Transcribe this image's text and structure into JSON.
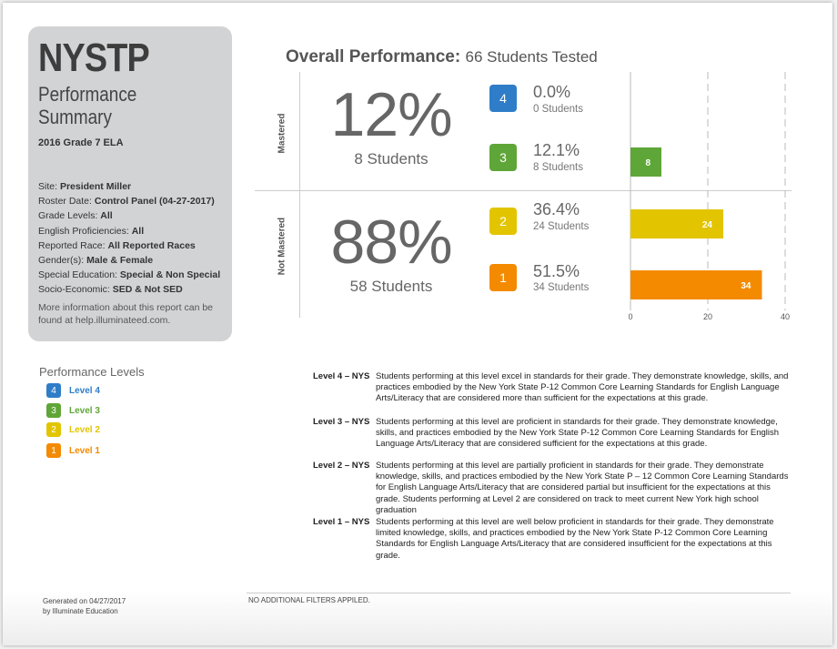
{
  "card": {
    "brand": "NYSTP",
    "subtitle_1": "Performance",
    "subtitle_2": "Summary",
    "grade": "2016 Grade 7 ELA",
    "meta": [
      {
        "label": "Site: ",
        "value": "President Miller"
      },
      {
        "label": "Roster Date: ",
        "value": "Control Panel (04-27-2017)"
      },
      {
        "label": "Grade Levels: ",
        "value": "All"
      },
      {
        "label": "English Proficiencies: ",
        "value": "All"
      },
      {
        "label": "Reported Race: ",
        "value": "All Reported Races"
      },
      {
        "label": "Gender(s): ",
        "value": "Male & Female"
      },
      {
        "label": "Special Education: ",
        "value": "Special & Non Special"
      },
      {
        "label": "Socio-Economic: ",
        "value": "SED & Not SED"
      }
    ],
    "more_info": "More information about this report can be found at help.illuminateed.com."
  },
  "legend": {
    "title": "Performance Levels",
    "items": [
      {
        "num": "4",
        "label": "Level 4",
        "color": "#2f7dc8"
      },
      {
        "num": "3",
        "label": "Level 3",
        "color": "#5fa638"
      },
      {
        "num": "2",
        "label": "Level 2",
        "color": "#e2c500"
      },
      {
        "num": "1",
        "label": "Level 1",
        "color": "#f48a00"
      }
    ]
  },
  "overall": {
    "title": "Overall Performance:",
    "tested": "66 Students Tested"
  },
  "groups": {
    "mastered": {
      "label": "Mastered",
      "pct": "12%",
      "students": "8 Students"
    },
    "not_mastered": {
      "label": "Not Mastered",
      "pct": "88%",
      "students": "58 Students"
    }
  },
  "levels": [
    {
      "num": "4",
      "pct": "0.0%",
      "students": "0 Students",
      "color": "#2f7dc8"
    },
    {
      "num": "3",
      "pct": "12.1%",
      "students": "8 Students",
      "color": "#5fa638"
    },
    {
      "num": "2",
      "pct": "36.4%",
      "students": "24 Students",
      "color": "#e2c500"
    },
    {
      "num": "1",
      "pct": "51.5%",
      "students": "34 Students",
      "color": "#f48a00"
    }
  ],
  "chart_data": {
    "type": "bar",
    "orientation": "horizontal",
    "categories": [
      "Level 4",
      "Level 3",
      "Level 2",
      "Level 1"
    ],
    "values": [
      0,
      8,
      24,
      34
    ],
    "data_labels": [
      "",
      "8",
      "24",
      "34"
    ],
    "colors": [
      "#2f7dc8",
      "#5fa638",
      "#e2c500",
      "#f48a00"
    ],
    "xlim": [
      0,
      40
    ],
    "xticks": [
      "0",
      "20",
      "40"
    ],
    "grid": "dashed vertical"
  },
  "descriptions": [
    {
      "level": "Level 4 – NYS",
      "text": "Students performing at this level excel in standards for their grade. They demonstrate knowledge, skills, and practices embodied by the New York State P-12 Common Core Learning Standards for English Language Arts/Literacy that are considered more than sufficient for the expectations at this grade."
    },
    {
      "level": "Level 3 – NYS",
      "text": "Students performing at this level are proficient in standards for their grade. They demonstrate knowledge, skills, and practices embodied by the New York State P-12 Common Core Learning Standards for English Language Arts/Literacy that are considered sufficient for the expectations at this grade."
    },
    {
      "level": "Level 2 – NYS",
      "text": "Students performing at this level are partially proficient in standards for their grade. They demonstrate knowledge, skills, and practices embodied by the New York State P – 12 Common Core Learning Standards for English Language Arts/Literacy that are considered partial but insufficient for the expectations at this grade. Students performing at Level 2 are considered on track to meet current New York high school graduation"
    },
    {
      "level": "Level 1 – NYS",
      "text": "Students performing at this level are well below proficient in standards for their grade. They demonstrate limited knowledge, skills, and practices embodied by the New York State P-12 Common Core Learning Standards for English Language Arts/Literacy that are considered insufficient for the expectations at this grade."
    }
  ],
  "footer": {
    "generated_1": "Generated on 04/27/2017",
    "generated_2": "by Illuminate Education",
    "note": "NO ADDITIONAL FILTERS APPILED."
  }
}
